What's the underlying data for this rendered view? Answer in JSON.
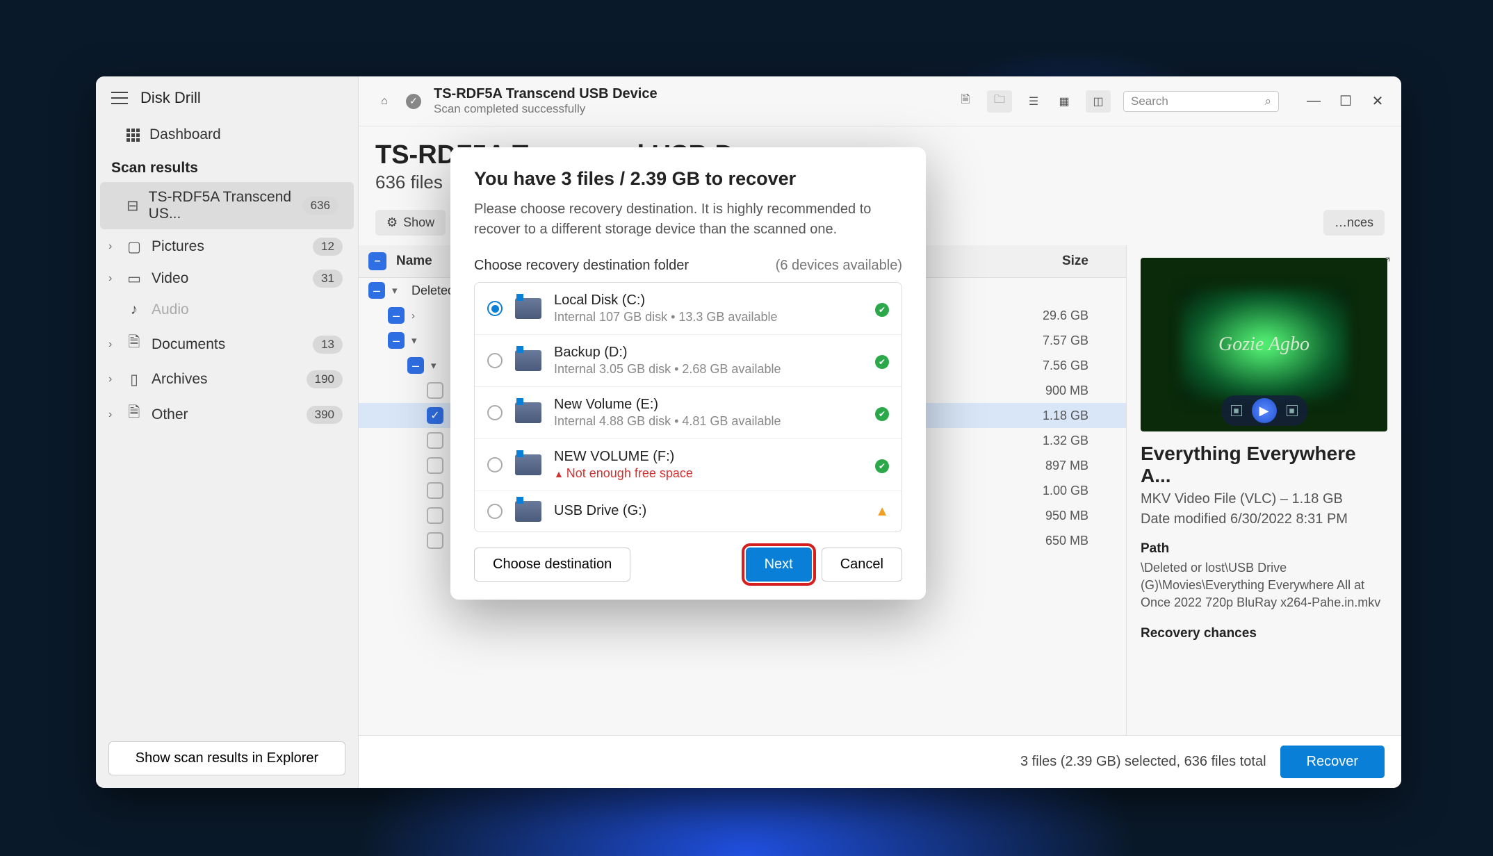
{
  "app": {
    "title": "Disk Drill"
  },
  "sidebar": {
    "dashboard": "Dashboard",
    "section": "Scan results",
    "items": [
      {
        "label": "TS-RDF5A Transcend US...",
        "count": "636",
        "active": true,
        "icon": "⊟"
      },
      {
        "label": "Pictures",
        "count": "12",
        "icon": "▢",
        "chev": true
      },
      {
        "label": "Video",
        "count": "31",
        "icon": "▭",
        "chev": true
      },
      {
        "label": "Audio",
        "count": "",
        "icon": "♪",
        "muted": true
      },
      {
        "label": "Documents",
        "count": "13",
        "icon": "🗎",
        "chev": true
      },
      {
        "label": "Archives",
        "count": "190",
        "icon": "▯",
        "chev": true
      },
      {
        "label": "Other",
        "count": "390",
        "icon": "🗎",
        "chev": true
      }
    ],
    "footer_btn": "Show scan results in Explorer"
  },
  "topbar": {
    "title": "TS-RDF5A Transcend USB Device",
    "subtitle": "Scan completed successfully",
    "search_placeholder": "Search"
  },
  "header": {
    "title": "TS-RDF5A Transcend USB Device",
    "subtitle": "636 files"
  },
  "filters": {
    "show": "Show",
    "chances": "…nces"
  },
  "table": {
    "col_name": "Name",
    "col_size": "Size",
    "rows": [
      {
        "cb": "half",
        "chev": "▾",
        "label": "Deleted or lost",
        "size": ""
      },
      {
        "cb": "half",
        "chev": "›",
        "label": "",
        "size": "29.6 GB",
        "indent": 1
      },
      {
        "cb": "half",
        "chev": "▾",
        "label": "",
        "size": "7.57 GB",
        "indent": 1
      },
      {
        "cb": "half",
        "chev": "▾",
        "label": "",
        "size": "7.56 GB",
        "indent": 2
      },
      {
        "cb": "",
        "label": "",
        "size": "900 MB",
        "indent": 3
      },
      {
        "cb": "checked",
        "label": "",
        "size": "1.18 GB",
        "indent": 3,
        "hl": true
      },
      {
        "cb": "",
        "label": "",
        "size": "1.32 GB",
        "indent": 3
      },
      {
        "cb": "",
        "label": "",
        "size": "897 MB",
        "indent": 3
      },
      {
        "cb": "",
        "label": "",
        "size": "1.00 GB",
        "indent": 3
      },
      {
        "cb": "",
        "label": "",
        "size": "950 MB",
        "indent": 3
      },
      {
        "cb": "",
        "label": "",
        "size": "650 MB",
        "indent": 3
      }
    ]
  },
  "preview": {
    "overlay_text": "Gozie Agbo",
    "title": "Everything Everywhere A...",
    "type_line": "MKV Video File (VLC) – 1.18 GB",
    "date_line": "Date modified 6/30/2022 8:31 PM",
    "path_label": "Path",
    "path_text": "\\Deleted or lost\\USB Drive (G)\\Movies\\Everything Everywhere All at Once 2022 720p BluRay x264-Pahe.in.mkv",
    "chances_label": "Recovery chances"
  },
  "status": {
    "info": "3 files (2.39 GB) selected, 636 files total",
    "recover": "Recover"
  },
  "dialog": {
    "title": "You have 3 files / 2.39 GB to recover",
    "desc": "Please choose recovery destination. It is highly recommended to recover to a different storage device than the scanned one.",
    "subhead": "Choose recovery destination folder",
    "count": "(6 devices available)",
    "destinations": [
      {
        "name": "Local Disk (C:)",
        "detail": "Internal 107 GB disk • 13.3 GB available",
        "status": "ok",
        "selected": true
      },
      {
        "name": "Backup (D:)",
        "detail": "Internal 3.05 GB disk • 2.68 GB available",
        "status": "ok"
      },
      {
        "name": "New Volume (E:)",
        "detail": "Internal 4.88 GB disk • 4.81 GB available",
        "status": "ok"
      },
      {
        "name": "NEW VOLUME (F:)",
        "detail": "Not enough free space",
        "status": "ok",
        "err": true
      },
      {
        "name": "USB Drive (G:)",
        "detail": "",
        "status": "warn"
      }
    ],
    "choose": "Choose destination",
    "next": "Next",
    "cancel": "Cancel"
  }
}
